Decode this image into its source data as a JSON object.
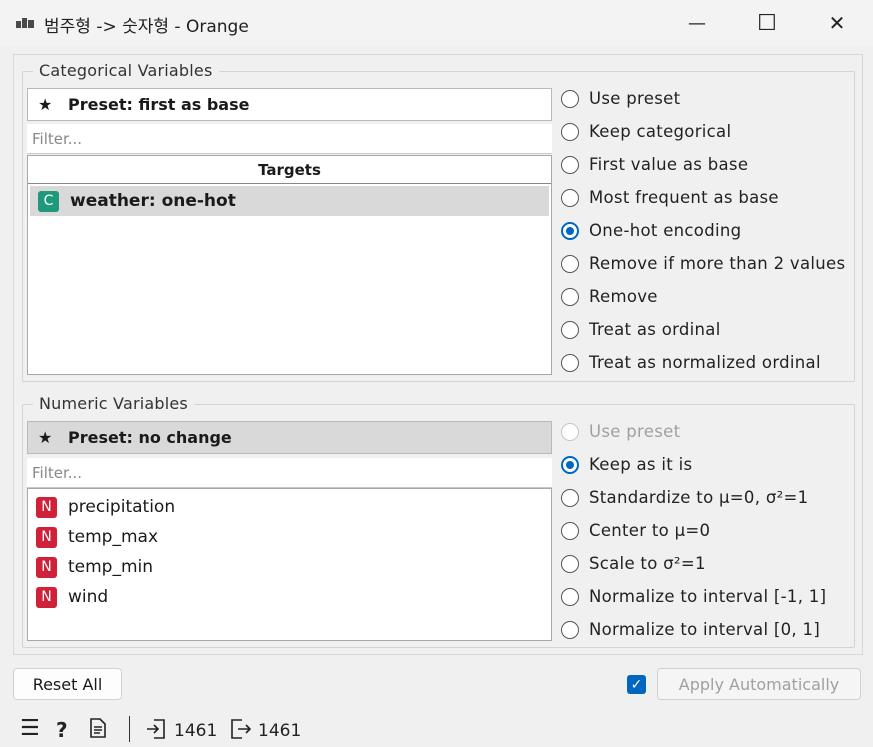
{
  "window": {
    "title": "범주형 -> 숫자형 - Orange",
    "minimize": "—",
    "maximize": "☐",
    "close": "✕"
  },
  "categorical": {
    "group_title": "Categorical Variables",
    "preset_label": "Preset: first as base",
    "filter_placeholder": "Filter...",
    "list_header": "Targets",
    "variables": [
      {
        "badge": "C",
        "name": "weather: one-hot"
      }
    ],
    "options": [
      {
        "label": "Use preset",
        "state": "unchecked"
      },
      {
        "label": "Keep categorical",
        "state": "unchecked"
      },
      {
        "label": "First value as base",
        "state": "unchecked"
      },
      {
        "label": "Most frequent as base",
        "state": "unchecked"
      },
      {
        "label": "One-hot encoding",
        "state": "checked"
      },
      {
        "label": "Remove if more than 2 values",
        "state": "unchecked"
      },
      {
        "label": "Remove",
        "state": "unchecked"
      },
      {
        "label": "Treat as ordinal",
        "state": "unchecked"
      },
      {
        "label": "Treat as normalized ordinal",
        "state": "unchecked"
      }
    ]
  },
  "numeric": {
    "group_title": "Numeric Variables",
    "preset_label": "Preset: no change",
    "filter_placeholder": "Filter...",
    "variables": [
      {
        "badge": "N",
        "name": "precipitation"
      },
      {
        "badge": "N",
        "name": "temp_max"
      },
      {
        "badge": "N",
        "name": "temp_min"
      },
      {
        "badge": "N",
        "name": "wind"
      }
    ],
    "options": [
      {
        "label": "Use preset",
        "state": "disabled"
      },
      {
        "label": "Keep as it is",
        "state": "checked"
      },
      {
        "label": "Standardize to μ=0, σ²=1",
        "state": "unchecked"
      },
      {
        "label": "Center to μ=0",
        "state": "unchecked"
      },
      {
        "label": "Scale to σ²=1",
        "state": "unchecked"
      },
      {
        "label": "Normalize to interval [-1, 1]",
        "state": "unchecked"
      },
      {
        "label": "Normalize to interval [0, 1]",
        "state": "unchecked"
      }
    ]
  },
  "footer": {
    "reset_label": "Reset All",
    "apply_label": "Apply Automatically",
    "apply_auto_checked": true
  },
  "statusbar": {
    "input_count": "1461",
    "output_count": "1461"
  },
  "colors": {
    "accent": "#0067c0",
    "categorical_badge": "#1e9a7a",
    "numeric_badge": "#d0213a"
  }
}
